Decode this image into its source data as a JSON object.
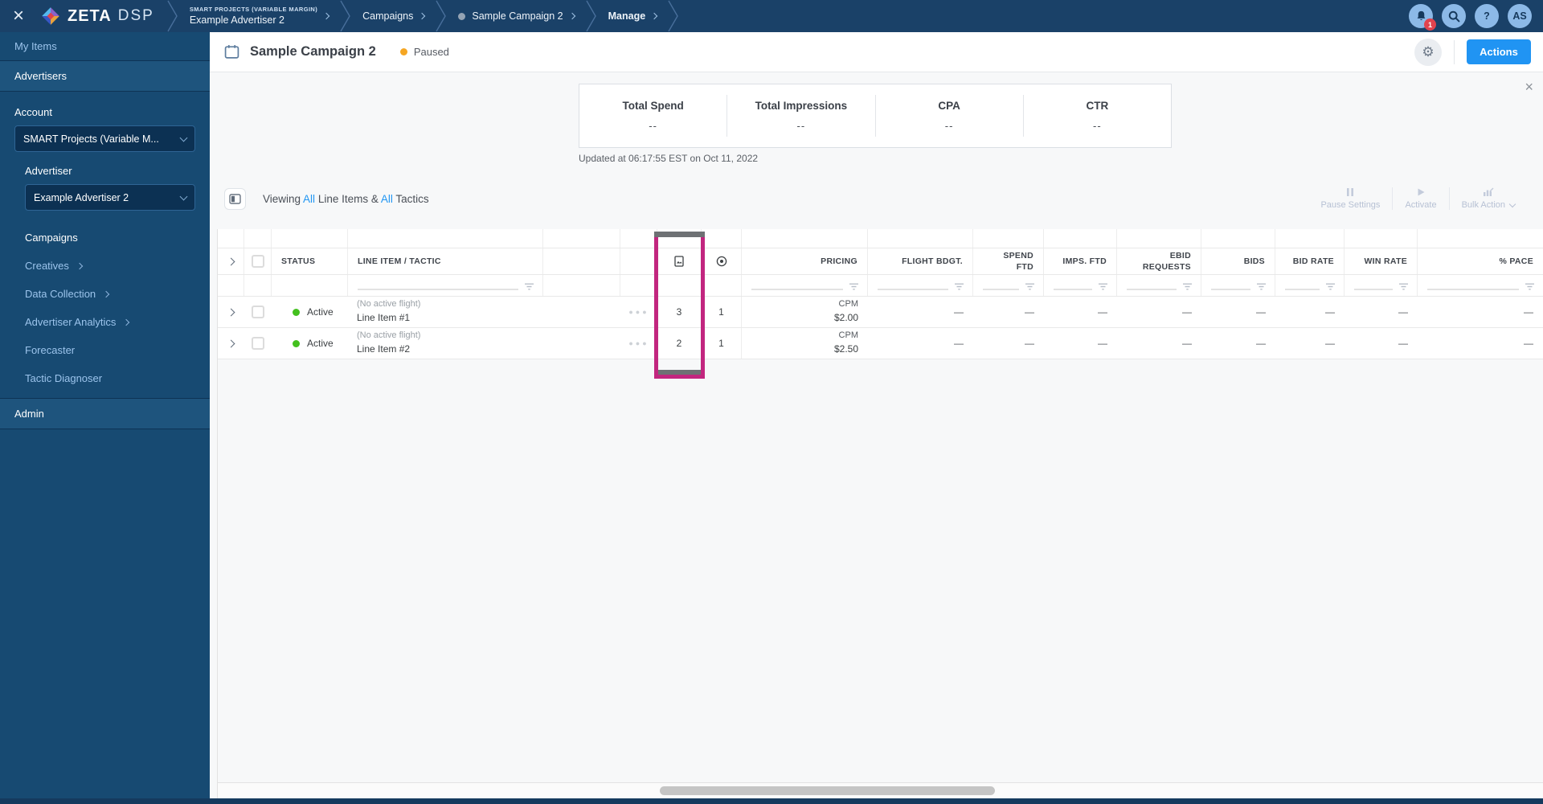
{
  "topbar": {
    "brand": {
      "zeta": "ZETA",
      "dsp": "DSP"
    },
    "breadcrumbs": {
      "account_eyebrow": "SMART PROJECTS (VARIABLE MARGIN)",
      "advertiser": "Example Advertiser 2",
      "campaigns": "Campaigns",
      "campaign": "Sample Campaign 2",
      "manage": "Manage"
    },
    "notification_badge": "1",
    "help": "?",
    "avatar": "AS"
  },
  "sidebar": {
    "my_items": "My Items",
    "advertisers": "Advertisers",
    "account_label": "Account",
    "account_value": "SMART Projects (Variable M...",
    "advertiser_label": "Advertiser",
    "advertiser_value": "Example Advertiser 2",
    "campaigns": "Campaigns",
    "creatives": "Creatives",
    "data_collection": "Data Collection",
    "advertiser_analytics": "Advertiser Analytics",
    "forecaster": "Forecaster",
    "tactic_diagnoser": "Tactic Diagnoser",
    "admin": "Admin"
  },
  "header": {
    "title": "Sample Campaign 2",
    "status": "Paused",
    "actions": "Actions"
  },
  "stats": {
    "cards": [
      {
        "label": "Total Spend",
        "value": "--"
      },
      {
        "label": "Total Impressions",
        "value": "--"
      },
      {
        "label": "CPA",
        "value": "--"
      },
      {
        "label": "CTR",
        "value": "--"
      }
    ],
    "updated": "Updated at 06:17:55 EST on Oct 11, 2022"
  },
  "toolbar": {
    "viewing": {
      "t1": "Viewing ",
      "all1": "All",
      "t2": " Line Items & ",
      "all2": "All",
      "t3": " Tactics"
    },
    "pause_settings": "Pause Settings",
    "activate": "Activate",
    "bulk_action": "Bulk Action"
  },
  "table": {
    "columns": {
      "status": "STATUS",
      "line_item": "LINE ITEM / TACTIC",
      "pricing": "PRICING",
      "flight_bdgt": "FLIGHT BDGT.",
      "spend_ftd": "SPEND\nFTD",
      "imps_ftd": "IMPS. FTD",
      "ebid_requests": "EBID\nREQUESTS",
      "bids": "BIDS",
      "bid_rate": "BID RATE",
      "win_rate": "WIN RATE",
      "pace": "% PACE"
    },
    "rows": [
      {
        "status": "Active",
        "flight_note": "(No active flight)",
        "name": "Line Item #1",
        "creatives": "3",
        "tactics": "1",
        "pricing_type": "CPM",
        "pricing_value": "$2.00",
        "flight_bdgt": "—",
        "spend_ftd": "—",
        "imps_ftd": "—",
        "ebid_requests": "—",
        "bids": "—",
        "bid_rate": "—",
        "win_rate": "—",
        "pace": "—"
      },
      {
        "status": "Active",
        "flight_note": "(No active flight)",
        "name": "Line Item #2",
        "creatives": "2",
        "tactics": "1",
        "pricing_type": "CPM",
        "pricing_value": "$2.50",
        "flight_bdgt": "—",
        "spend_ftd": "—",
        "imps_ftd": "—",
        "ebid_requests": "—",
        "bids": "—",
        "bid_rate": "—",
        "win_rate": "—",
        "pace": "—"
      }
    ]
  }
}
